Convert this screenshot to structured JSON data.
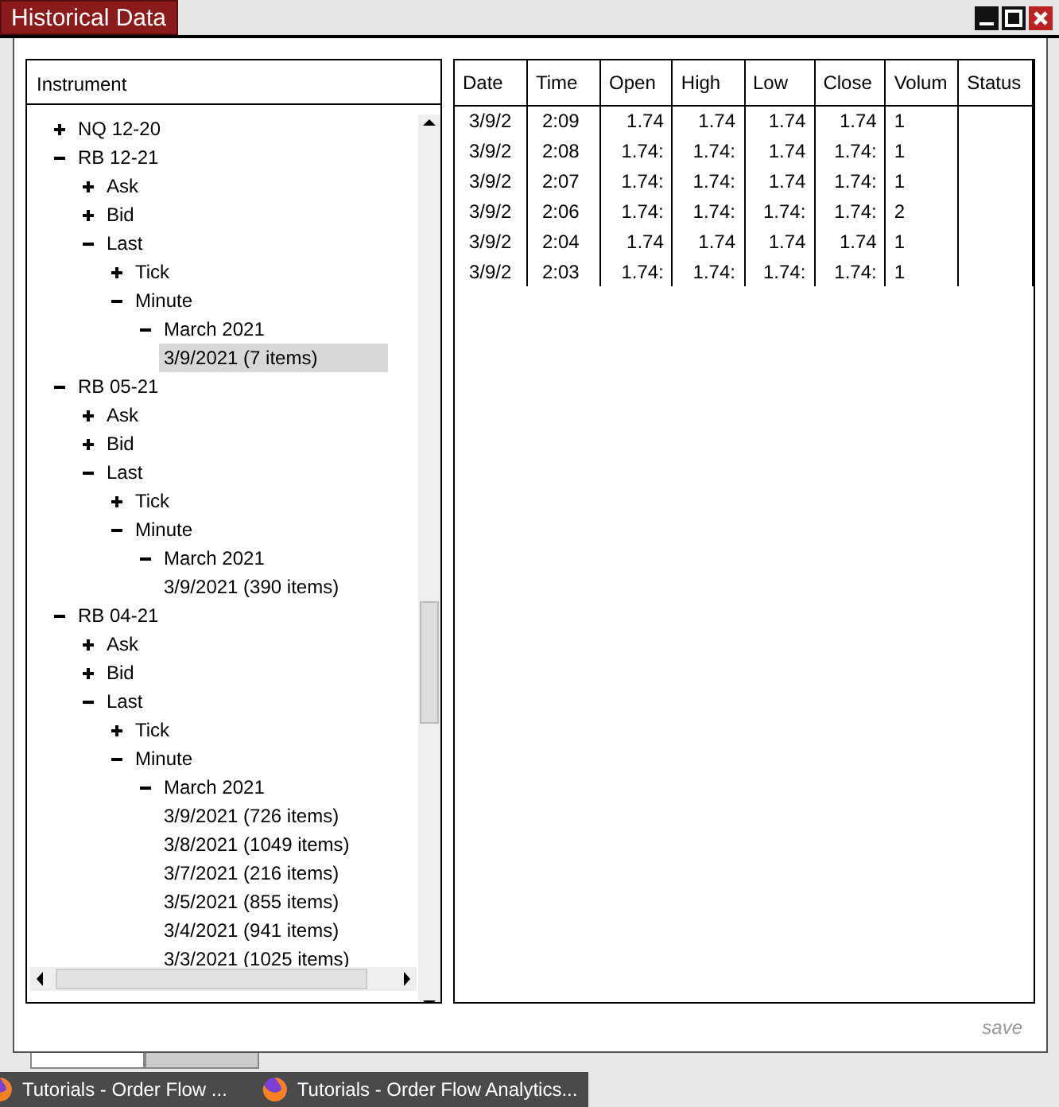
{
  "window": {
    "title": "Historical Data"
  },
  "tree": {
    "header": "Instrument",
    "items": [
      {
        "label": "NQ 12-20",
        "expanded": false
      },
      {
        "label": "RB 12-21",
        "expanded": true,
        "children": [
          {
            "label": "Ask",
            "expanded": false
          },
          {
            "label": "Bid",
            "expanded": false
          },
          {
            "label": "Last",
            "expanded": true,
            "children": [
              {
                "label": "Tick",
                "expanded": false
              },
              {
                "label": "Minute",
                "expanded": true,
                "children": [
                  {
                    "label": "March 2021",
                    "expanded": true,
                    "children": [
                      {
                        "label": "3/9/2021 (7 items)",
                        "selected": true
                      }
                    ]
                  }
                ]
              }
            ]
          }
        ]
      },
      {
        "label": "RB 05-21",
        "expanded": true,
        "children": [
          {
            "label": "Ask",
            "expanded": false
          },
          {
            "label": "Bid",
            "expanded": false
          },
          {
            "label": "Last",
            "expanded": true,
            "children": [
              {
                "label": "Tick",
                "expanded": false
              },
              {
                "label": "Minute",
                "expanded": true,
                "children": [
                  {
                    "label": "March 2021",
                    "expanded": true,
                    "children": [
                      {
                        "label": "3/9/2021 (390 items)",
                        "selected": false
                      }
                    ]
                  }
                ]
              }
            ]
          }
        ]
      },
      {
        "label": "RB 04-21",
        "expanded": true,
        "children": [
          {
            "label": "Ask",
            "expanded": false
          },
          {
            "label": "Bid",
            "expanded": false
          },
          {
            "label": "Last",
            "expanded": true,
            "children": [
              {
                "label": "Tick",
                "expanded": false
              },
              {
                "label": "Minute",
                "expanded": true,
                "children": [
                  {
                    "label": "March 2021",
                    "expanded": true,
                    "children": [
                      {
                        "label": "3/9/2021 (726 items)",
                        "selected": false
                      },
                      {
                        "label": "3/8/2021 (1049 items)",
                        "selected": false
                      },
                      {
                        "label": "3/7/2021 (216 items)",
                        "selected": false
                      },
                      {
                        "label": "3/5/2021 (855 items)",
                        "selected": false
                      },
                      {
                        "label": "3/4/2021 (941 items)",
                        "selected": false
                      },
                      {
                        "label": "3/3/2021 (1025 items)",
                        "selected": false
                      }
                    ]
                  }
                ]
              }
            ]
          }
        ]
      }
    ]
  },
  "table": {
    "columns": [
      "Date",
      "Time",
      "Open",
      "High",
      "Low",
      "Close",
      "Volum",
      "Status"
    ],
    "rows": [
      [
        "3/9/2",
        "2:09",
        "1.74",
        "1.74",
        "1.74",
        "1.74",
        "1"
      ],
      [
        "3/9/2",
        "2:08",
        "1.74:",
        "1.74:",
        "1.74",
        "1.74:",
        "1"
      ],
      [
        "3/9/2",
        "2:07",
        "1.74:",
        "1.74:",
        "1.74",
        "1.74:",
        "1"
      ],
      [
        "3/9/2",
        "2:06",
        "1.74:",
        "1.74:",
        "1.74:",
        "1.74:",
        "2"
      ],
      [
        "3/9/2",
        "2:04",
        "1.74",
        "1.74",
        "1.74",
        "1.74",
        "1"
      ],
      [
        "3/9/2",
        "2:03",
        "1.74:",
        "1.74:",
        "1.74:",
        "1.74:",
        "1"
      ]
    ]
  },
  "save_label": "save",
  "tabs": [
    {
      "selected": true
    },
    {
      "selected": false
    }
  ],
  "taskbar": [
    "Tutorials - Order Flow ...",
    "Tutorials - Order Flow Analytics..."
  ]
}
